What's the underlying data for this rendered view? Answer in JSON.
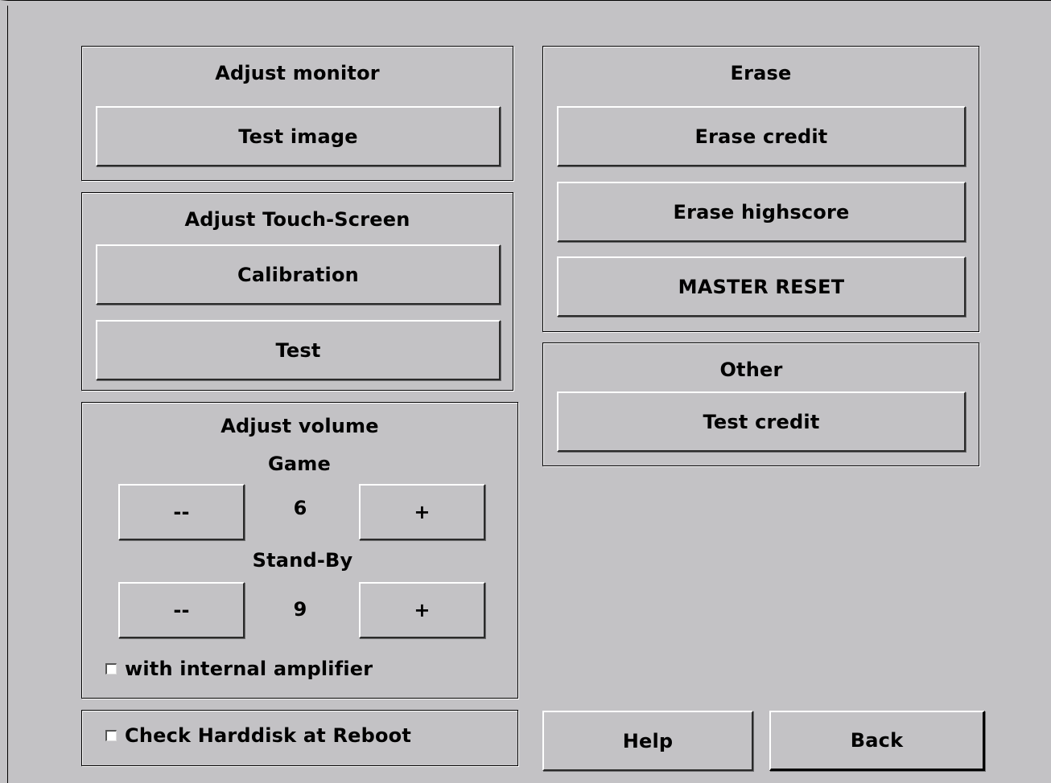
{
  "adjust_monitor": {
    "title": "Adjust monitor",
    "test_image_label": "Test image"
  },
  "adjust_touch": {
    "title": "Adjust Touch-Screen",
    "calibration_label": "Calibration",
    "test_label": "Test"
  },
  "adjust_volume": {
    "title": "Adjust volume",
    "game": {
      "label": "Game",
      "decrease_label": "--",
      "value": "6",
      "increase_label": "+"
    },
    "standby": {
      "label": "Stand-By",
      "decrease_label": "--",
      "value": "9",
      "increase_label": "+"
    },
    "amplifier_checkbox": {
      "label": "with internal amplifier",
      "checked": false
    }
  },
  "check_harddisk": {
    "label": "Check Harddisk at Reboot",
    "checked": false
  },
  "erase": {
    "title": "Erase",
    "erase_credit_label": "Erase credit",
    "erase_highscore_label": "Erase highscore",
    "master_reset_label": "MASTER RESET"
  },
  "other": {
    "title": "Other",
    "test_credit_label": "Test credit"
  },
  "footer": {
    "help_label": "Help",
    "back_label": "Back"
  },
  "colors": {
    "background": "#c3c2c5",
    "border_dark": "#000000",
    "highlight": "#ffffff"
  }
}
